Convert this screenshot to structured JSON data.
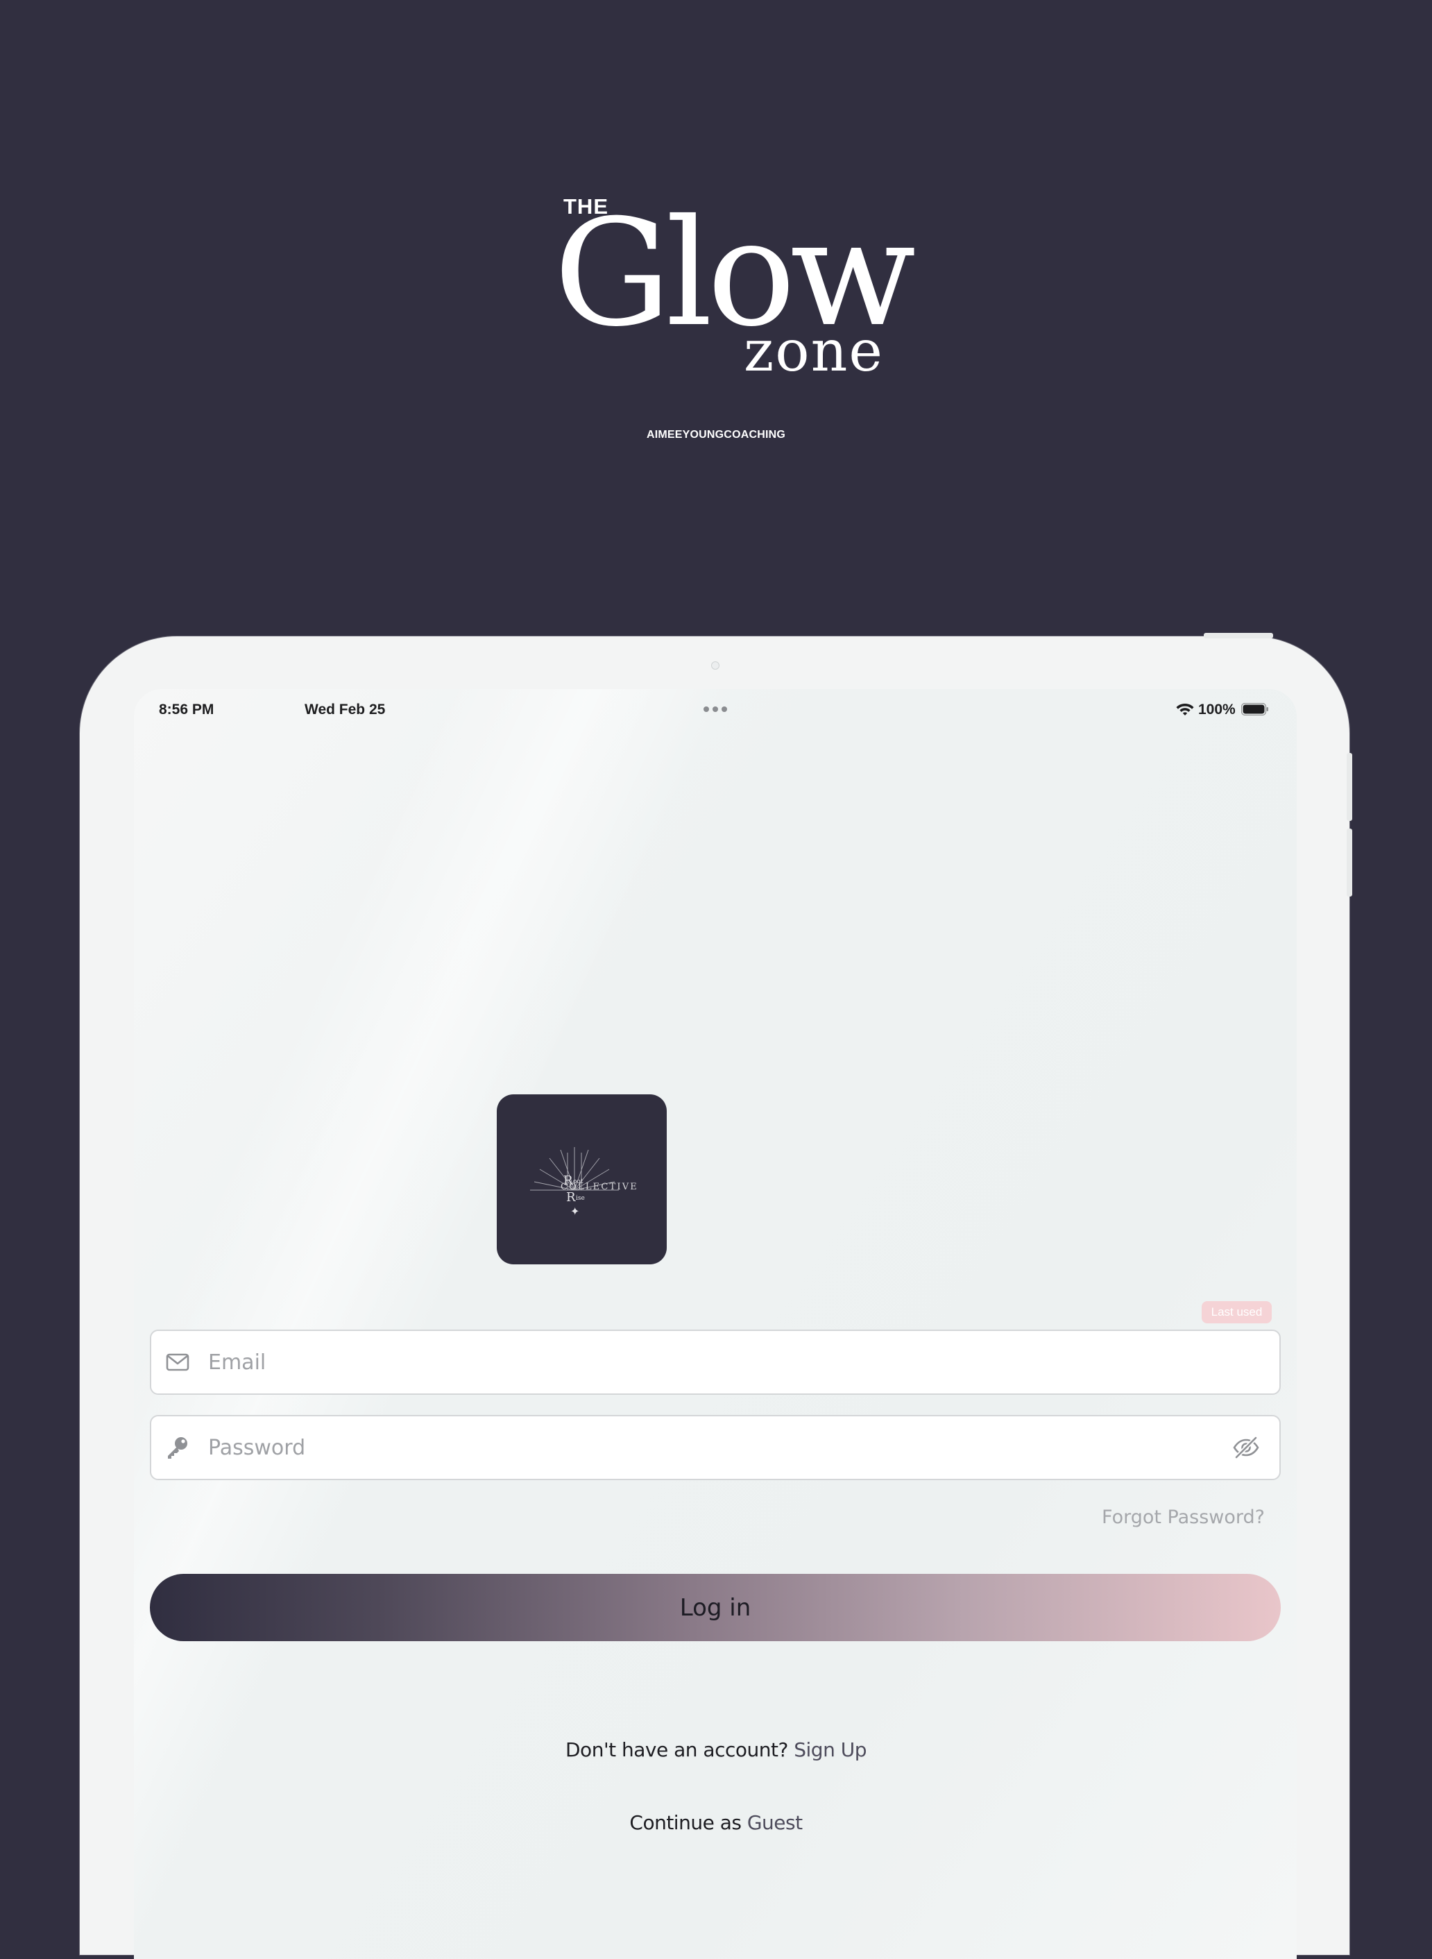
{
  "brand": {
    "the": "THE",
    "glow": "Glow",
    "zone": "zone",
    "subtitle": "AIMEEYOUNGCOACHING"
  },
  "status_bar": {
    "time": "8:56 PM",
    "date": "Wed Feb 25",
    "battery": "100%"
  },
  "app_logo": {
    "name": "COLLECTIVE"
  },
  "login": {
    "last_used": "Last used",
    "email_placeholder": "Email",
    "password_placeholder": "Password",
    "forgot_password": "Forgot Password?",
    "login_label": "Log in",
    "no_account": "Don't have an account?",
    "sign_up": "Sign Up",
    "continue_as": "Continue as",
    "guest": "Guest"
  },
  "colors": {
    "background": "#312f40",
    "device": "#f3f4f4",
    "last_used_bg": "#f5d3d6",
    "button_gradient_start": "#302e40",
    "button_gradient_end": "#e9c6ca"
  },
  "icons": [
    "mail-icon",
    "key-icon",
    "eye-off-icon",
    "wifi-icon",
    "battery-icon",
    "more-dots-icon"
  ]
}
